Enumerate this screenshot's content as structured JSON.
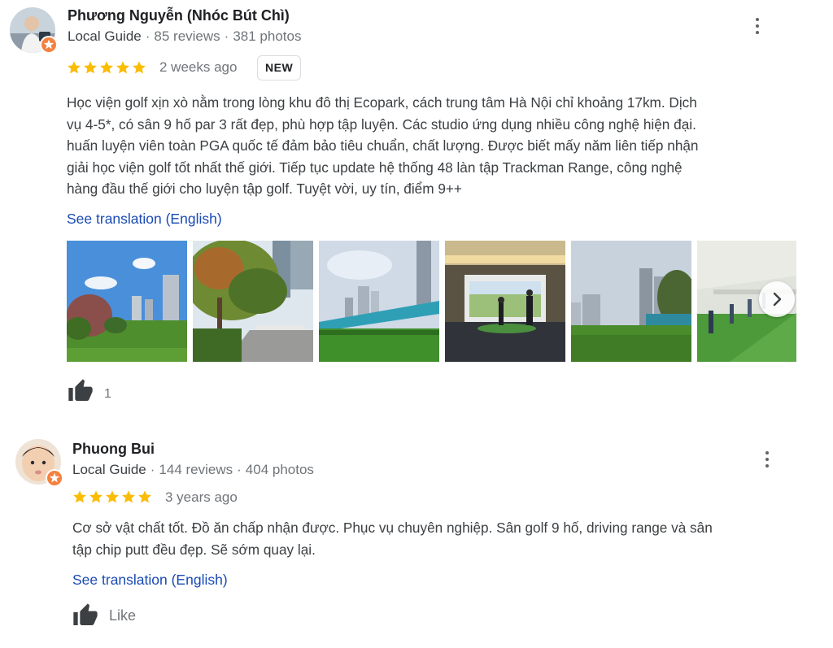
{
  "colors": {
    "star": "#fbbc04",
    "link": "#1a4ab5",
    "guide_badge": "#f5813f",
    "muted_text": "#70757a"
  },
  "reviews": [
    {
      "author": "Phương Nguyễn (Nhóc Bút Chì)",
      "guide_label": "Local Guide",
      "reviews_count": "85 reviews",
      "photos_count": "381 photos",
      "rating": 5,
      "time": "2 weeks ago",
      "badge": "NEW",
      "text_lines": [
        "Học viện golf xịn xò nằm trong lòng khu đô thị Ecopark, cách trung tâm Hà Nội chỉ khoảng 17km. Dịch",
        "vụ 4-5*, có sân 9 hố par 3 rất đẹp, phù hợp tập luyện. Các studio ứng dụng nhiều công nghệ hiện đại.",
        "huấn luyện viên toàn PGA quốc tế đảm bảo tiêu chuẩn, chất lượng. Được biết mấy năm liên tiếp nhận",
        "giải học viện golf tốt nhất thế giới. Tiếp tục update hệ thống 48 làn tập Trackman Range, công nghệ",
        "hàng đầu thế giới cho luyện tập golf. Tuyệt vời, uy tín, điểm 9++"
      ],
      "translate_link": "See translation (English)",
      "like_count": "1",
      "photos": [
        "park-towers-photo",
        "tree-lined-road-photo",
        "driving-range-photo",
        "golf-simulator-studio-photo",
        "fairway-towers-photo",
        "covered-range-bays-photo"
      ],
      "icons": [
        "more-options-icon",
        "local-guide-badge-icon",
        "star-icon",
        "thumb-up-icon",
        "chevron-right-icon"
      ]
    },
    {
      "author": "Phuong Bui",
      "guide_label": "Local Guide",
      "reviews_count": "144 reviews",
      "photos_count": "404 photos",
      "rating": 5,
      "time": "3 years ago",
      "text_lines": [
        "Cơ sở vật chất tốt. Đồ ăn chấp nhận được. Phục vụ chuyên nghiệp. Sân golf 9 hố, driving range và sân",
        "tập chip putt đều đẹp. Sẽ sớm quay lại."
      ],
      "translate_link": "See translation (English)",
      "like_label": "Like",
      "icons": [
        "more-options-icon",
        "local-guide-badge-icon",
        "star-icon",
        "thumb-up-icon"
      ]
    }
  ]
}
